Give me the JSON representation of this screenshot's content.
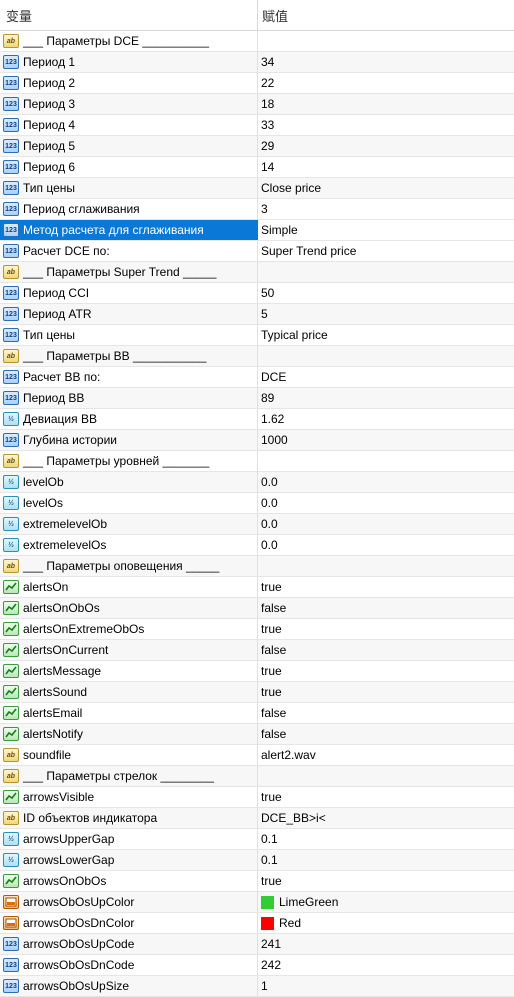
{
  "header": {
    "col_name": "变量",
    "col_value": "赋值"
  },
  "rows": [
    {
      "icon": "str",
      "name": "___ Параметры DCE __________",
      "value": ""
    },
    {
      "icon": "int",
      "name": "Период 1",
      "value": "34"
    },
    {
      "icon": "int",
      "name": "Период 2",
      "value": "22"
    },
    {
      "icon": "int",
      "name": "Период 3",
      "value": "18"
    },
    {
      "icon": "int",
      "name": "Период 4",
      "value": "33"
    },
    {
      "icon": "int",
      "name": "Период 5",
      "value": "29"
    },
    {
      "icon": "int",
      "name": "Период 6",
      "value": "14"
    },
    {
      "icon": "int",
      "name": "Тип цены",
      "value": "Close price"
    },
    {
      "icon": "int",
      "name": "Период сглаживания",
      "value": "3"
    },
    {
      "icon": "int",
      "name": "Метод расчета для сглаживания",
      "value": "Simple",
      "selected": true
    },
    {
      "icon": "int",
      "name": "Расчет DCE по:",
      "value": "Super Trend price"
    },
    {
      "icon": "str",
      "name": "___ Параметры Super Trend _____",
      "value": ""
    },
    {
      "icon": "int",
      "name": "Период CCI",
      "value": "50"
    },
    {
      "icon": "int",
      "name": "Период ATR",
      "value": "5"
    },
    {
      "icon": "int",
      "name": "Тип цены",
      "value": "Typical price"
    },
    {
      "icon": "str",
      "name": "___ Параметры BB ___________",
      "value": ""
    },
    {
      "icon": "int",
      "name": "Расчет BB по:",
      "value": "DCE"
    },
    {
      "icon": "int",
      "name": "Период BB",
      "value": "89"
    },
    {
      "icon": "dbl",
      "name": "Девиация BB",
      "value": "1.62"
    },
    {
      "icon": "int",
      "name": "Глубина истории",
      "value": "1000"
    },
    {
      "icon": "str",
      "name": "___ Параметры уровней _______",
      "value": ""
    },
    {
      "icon": "dbl",
      "name": "levelOb",
      "value": "0.0"
    },
    {
      "icon": "dbl",
      "name": "levelOs",
      "value": "0.0"
    },
    {
      "icon": "dbl",
      "name": "extremelevelOb",
      "value": "0.0"
    },
    {
      "icon": "dbl",
      "name": "extremelevelOs",
      "value": "0.0"
    },
    {
      "icon": "str",
      "name": "___ Параметры оповещения _____",
      "value": ""
    },
    {
      "icon": "bool",
      "name": "alertsOn",
      "value": "true"
    },
    {
      "icon": "bool",
      "name": "alertsOnObOs",
      "value": "false"
    },
    {
      "icon": "bool",
      "name": "alertsOnExtremeObOs",
      "value": "true"
    },
    {
      "icon": "bool",
      "name": "alertsOnCurrent",
      "value": "false"
    },
    {
      "icon": "bool",
      "name": "alertsMessage",
      "value": "true"
    },
    {
      "icon": "bool",
      "name": "alertsSound",
      "value": "true"
    },
    {
      "icon": "bool",
      "name": "alertsEmail",
      "value": "false"
    },
    {
      "icon": "bool",
      "name": "alertsNotify",
      "value": "false"
    },
    {
      "icon": "str",
      "name": "soundfile",
      "value": "alert2.wav"
    },
    {
      "icon": "str",
      "name": "___ Параметры стрелок ________",
      "value": ""
    },
    {
      "icon": "bool",
      "name": "arrowsVisible",
      "value": "true"
    },
    {
      "icon": "str",
      "name": "ID объектов индикатора",
      "value": "DCE_BB>i<"
    },
    {
      "icon": "dbl",
      "name": "arrowsUpperGap",
      "value": "0.1"
    },
    {
      "icon": "dbl",
      "name": "arrowsLowerGap",
      "value": "0.1"
    },
    {
      "icon": "bool",
      "name": "arrowsOnObOs",
      "value": "true"
    },
    {
      "icon": "clr",
      "name": "arrowsObOsUpColor",
      "value": "LimeGreen",
      "swatch": "#32cd32"
    },
    {
      "icon": "clr",
      "name": "arrowsObOsDnColor",
      "value": "Red",
      "swatch": "#ff0000"
    },
    {
      "icon": "int",
      "name": "arrowsObOsUpCode",
      "value": "241"
    },
    {
      "icon": "int",
      "name": "arrowsObOsDnCode",
      "value": "242"
    },
    {
      "icon": "int",
      "name": "arrowsObOsUpSize",
      "value": "1"
    }
  ],
  "icon_labels": {
    "int": "123",
    "dbl": "½",
    "str": "ab",
    "bool": "",
    "clr": ""
  }
}
